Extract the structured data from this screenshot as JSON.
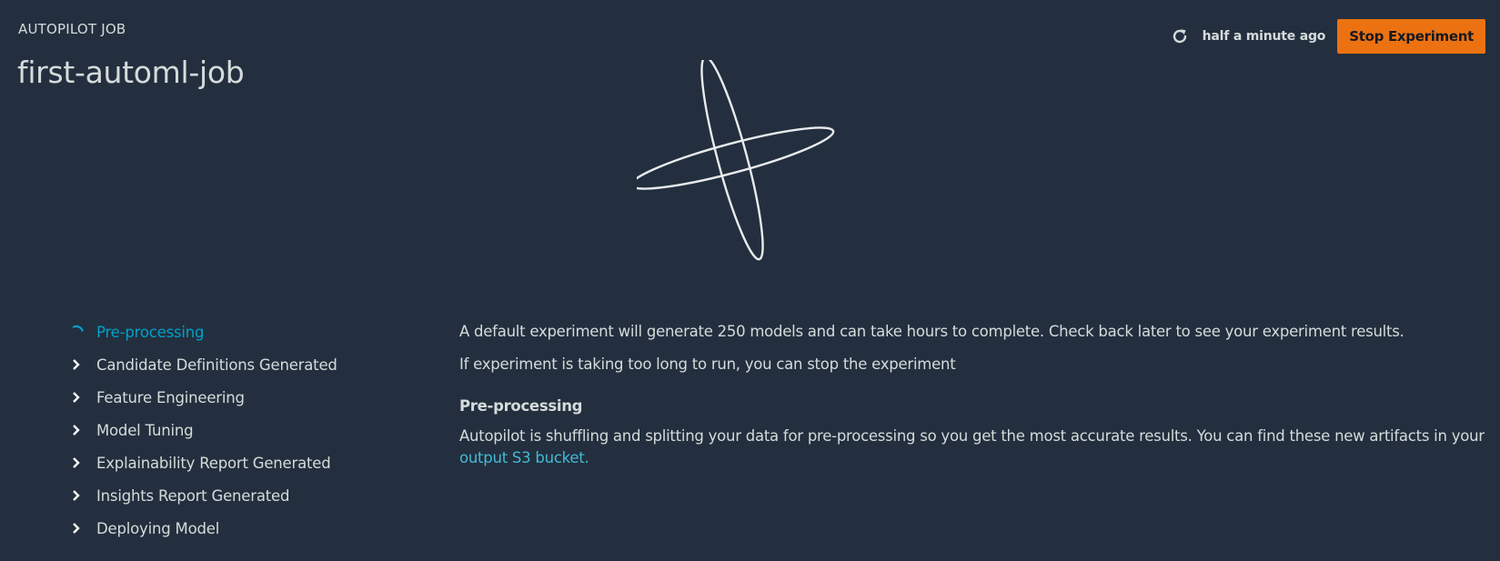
{
  "header": {
    "eyebrow": "AUTOPILOT JOB",
    "title": "first-automl-job",
    "last_updated": "half a minute ago",
    "refresh_icon": "refresh-icon",
    "stop_button_label": "Stop Experiment"
  },
  "colors": {
    "background": "#232f3e",
    "text": "#d5dbdb",
    "accent_active": "#00a1c9",
    "link": "#44b9d6",
    "primary_button": "#ec7211"
  },
  "steps": [
    {
      "label": "Pre-processing",
      "status": "in-progress",
      "icon": "spinner-icon"
    },
    {
      "label": "Candidate Definitions Generated",
      "status": "pending",
      "icon": "chevron-right-icon"
    },
    {
      "label": "Feature Engineering",
      "status": "pending",
      "icon": "chevron-right-icon"
    },
    {
      "label": "Model Tuning",
      "status": "pending",
      "icon": "chevron-right-icon"
    },
    {
      "label": "Explainability Report Generated",
      "status": "pending",
      "icon": "chevron-right-icon"
    },
    {
      "label": "Insights Report Generated",
      "status": "pending",
      "icon": "chevron-right-icon"
    },
    {
      "label": "Deploying Model",
      "status": "pending",
      "icon": "chevron-right-icon"
    }
  ],
  "content": {
    "intro": "A default experiment will generate 250 models and can take hours to complete. Check back later to see your experiment results.",
    "stop_hint": "If experiment is taking too long to run, you can stop the experiment",
    "section_title": "Pre-processing",
    "section_body": "Autopilot is shuffling and splitting your data for pre-processing so you get the most accurate results. You can find these new artifacts in your ",
    "section_link": "output S3 bucket."
  }
}
